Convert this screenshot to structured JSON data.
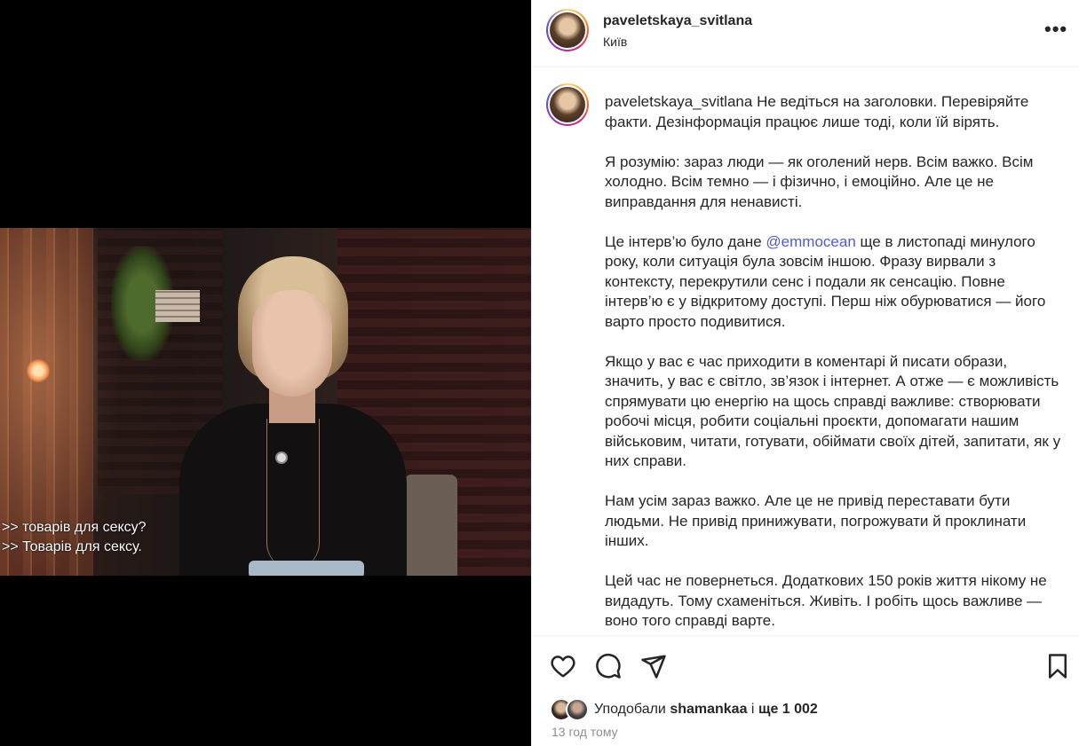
{
  "post": {
    "username": "paveletskaya_svitlana",
    "location": "Київ",
    "more_label": "•••"
  },
  "video": {
    "subtitle_line1": ">> товарів для сексу?",
    "subtitle_line2": ">> Товарів для сексу."
  },
  "caption": {
    "username": "paveletskaya_svitlana",
    "p1": "Не ведіться на заголовки. Перевіряйте факти. Дезінформація працює лише тоді, коли їй вірять.",
    "p2": "Я розумію: зараз люди — як оголений нерв. Всім важко. Всім холодно. Всім темно — і фізично, і емоційно. Але це не виправдання для ненависті.",
    "p3_before": "Це інтерв’ю було дане ",
    "p3_mention": "@emmocean",
    "p3_after": " ще в листопаді минулого року, коли ситуація була зовсім іншою. Фразу вирвали з контексту, перекрутили сенс і подали як сенсацію. Повне інтерв’ю є у відкритому доступі. Перш ніж обурюватися — його варто просто подивитися.",
    "p4": "Якщо у вас є час приходити в коментарі й писати образи, значить, у вас є світло, зв’язок і інтернет. А отже — є можливість спрямувати цю енергію на щось справді важливе: створювати робочі місця, робити соціальні проєкти, допомагати нашим військовим, читати, готувати, обіймати своїх дітей, запитати, як у них справи.",
    "p5": "Нам усім зараз важко. Але це не привід переставати бути людьми. Не привід принижувати, погрожувати й проклинати інших.",
    "p6": "Цей час не повернеться. Додаткових 150 років життя нікому не видадуть. Тому схаменіться. Живіть. І робіть щось важливе — воно того справді варте."
  },
  "actions": {
    "icons": [
      "heart-icon",
      "comment-icon",
      "share-icon",
      "bookmark-icon"
    ]
  },
  "likes": {
    "prefix": "Уподобали ",
    "user": "shamankaa",
    "middle": " і ",
    "count": "ще 1 002"
  },
  "timestamp": "13 год тому"
}
